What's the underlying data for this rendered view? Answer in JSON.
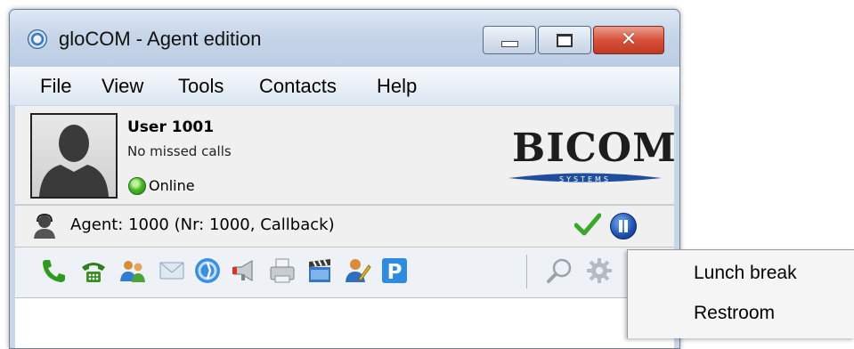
{
  "window": {
    "title": "gloCOM - Agent edition",
    "app_icon": "glocom-logo-icon",
    "controls": {
      "minimize": "minimize-icon",
      "maximize": "maximize-icon",
      "close": "close-icon",
      "close_glyph": "✕"
    }
  },
  "menubar": {
    "items": [
      {
        "label": "File"
      },
      {
        "label": "View"
      },
      {
        "label": "Tools"
      },
      {
        "label": "Contacts"
      },
      {
        "label": "Help"
      }
    ]
  },
  "user": {
    "name": "User 1001",
    "missed_calls": "No missed calls",
    "status": "Online",
    "status_color": "#4cb82b",
    "avatar": "avatar-silhouette-icon"
  },
  "brand": {
    "logo_text": "BICOM",
    "logo_subtext": "SYSTEMS",
    "accent": "#1f4e9c"
  },
  "agent": {
    "text": "Agent: 1000 (Nr: 1000, Callback)",
    "icons": [
      "agent-headset-icon",
      "check-icon",
      "pause-icon"
    ]
  },
  "toolbar": {
    "icons": [
      "phone-icon",
      "conference-phone-icon",
      "contacts-icon",
      "mail-icon",
      "chat-icon",
      "megaphone-icon",
      "fax-icon",
      "video-clapper-icon",
      "agent-edit-icon",
      "parking-icon",
      "search-icon",
      "gear-icon"
    ],
    "parking_label": "P"
  },
  "context_menu": {
    "items": [
      {
        "label": "Lunch break"
      },
      {
        "label": "Restroom"
      }
    ]
  }
}
